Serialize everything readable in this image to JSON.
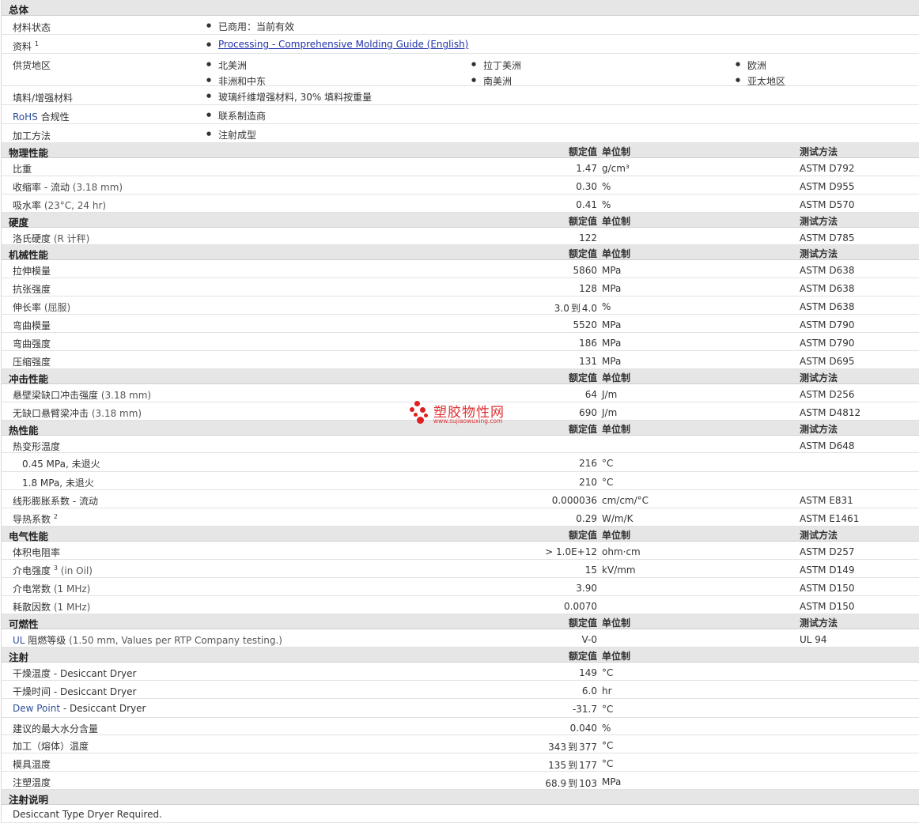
{
  "general": {
    "title": "总体",
    "material_status": {
      "label": "材料状态",
      "value": "已商用：当前有效"
    },
    "literature": {
      "label": "资料",
      "sup": "1",
      "link": "Processing - Comprehensive Molding Guide (English)"
    },
    "availability": {
      "label": "供货地区",
      "regions": [
        "北美洲",
        "拉丁美洲",
        "欧洲",
        "非洲和中东",
        "南美洲",
        "亚太地区"
      ]
    },
    "filler": {
      "label": "填料/增强材料",
      "value": "玻璃纤维增强材料, 30% 填料按重量"
    },
    "rohs": {
      "label_a": "RoHS",
      "label_b": " 合规性",
      "value": "联系制造商"
    },
    "processing_method": {
      "label": "加工方法",
      "value": "注射成型"
    }
  },
  "headers": {
    "nominal": "额定值",
    "unit": "单位制",
    "test": "测试方法"
  },
  "sections": [
    {
      "title": "物理性能",
      "rows": [
        {
          "label": "比重",
          "value": "1.47",
          "unit": "g/cm³",
          "test": "ASTM D792"
        },
        {
          "label": "收缩率 ",
          "suffix": "- 流动 ",
          "paren": "(3.18 mm)",
          "value": "0.30",
          "unit": "%",
          "test": "ASTM D955"
        },
        {
          "label": "吸水率 ",
          "paren": "(23°C, 24 hr)",
          "value": "0.41",
          "unit": "%",
          "test": "ASTM D570"
        }
      ]
    },
    {
      "title": "硬度",
      "rows": [
        {
          "label": "洛氏硬度 ",
          "paren": "(R 计秤)",
          "value": "122",
          "unit": "",
          "test": "ASTM D785"
        }
      ]
    },
    {
      "title": "机械性能",
      "rows": [
        {
          "label": "拉伸模量",
          "value": "5860",
          "unit": "MPa",
          "test": "ASTM D638"
        },
        {
          "label": "抗张强度",
          "value": "128",
          "unit": "MPa",
          "test": "ASTM D638"
        },
        {
          "label": "伸长率 ",
          "paren": "(屈服)",
          "value_from": "3.0",
          "to": "到",
          "value_to": "4.0",
          "unit": "%",
          "test": "ASTM D638"
        },
        {
          "label": "弯曲模量",
          "value": "5520",
          "unit": "MPa",
          "test": "ASTM D790"
        },
        {
          "label": "弯曲强度",
          "value": "186",
          "unit": "MPa",
          "test": "ASTM D790"
        },
        {
          "label": "压缩强度",
          "value": "131",
          "unit": "MPa",
          "test": "ASTM D695"
        }
      ]
    },
    {
      "title": "冲击性能",
      "rows": [
        {
          "label": "悬壁梁缺口冲击强度 ",
          "paren": "(3.18 mm)",
          "value": "64",
          "unit": "J/m",
          "test": "ASTM D256"
        },
        {
          "label": "无缺口悬臂梁冲击 ",
          "paren": "(3.18 mm)",
          "value": "690",
          "unit": "J/m",
          "test": "ASTM D4812"
        }
      ]
    },
    {
      "title": "热性能",
      "rows": [
        {
          "label": "热变形温度",
          "value": "",
          "unit": "",
          "test": "ASTM D648"
        },
        {
          "label": "0.45 MPa, 未退火",
          "indent": true,
          "value": "216",
          "unit": "°C",
          "test": ""
        },
        {
          "label": "1.8 MPa, 未退火",
          "indent": true,
          "value": "210",
          "unit": "°C",
          "test": ""
        },
        {
          "label": "线形膨胀系数 ",
          "suffix": "- 流动",
          "value": "0.000036",
          "unit": "cm/cm/°C",
          "test": "ASTM E831"
        },
        {
          "label": "导热系数 ",
          "sup": "2",
          "value": "0.29",
          "unit": "W/m/K",
          "test": "ASTM E1461"
        }
      ]
    },
    {
      "title": "电气性能",
      "rows": [
        {
          "label": "体积电阻率",
          "value": "> 1.0E+12",
          "unit": "ohm·cm",
          "test": "ASTM D257"
        },
        {
          "label": "介电强度 ",
          "sup": "3",
          "paren": " (in Oil)",
          "value": "15",
          "unit": "kV/mm",
          "test": "ASTM D149"
        },
        {
          "label": "介电常数 ",
          "paren": "(1 MHz)",
          "value": "3.90",
          "unit": "",
          "test": "ASTM D150"
        },
        {
          "label": "耗散因数 ",
          "paren": "(1 MHz)",
          "value": "0.0070",
          "unit": "",
          "test": "ASTM D150"
        }
      ]
    },
    {
      "title": "可燃性",
      "rows": [
        {
          "label_blue": "UL",
          "label": " 阻燃等级 ",
          "paren": "(1.50 mm, Values per RTP Company testing.)",
          "value": "V-0",
          "unit": "",
          "test": "UL 94"
        }
      ]
    },
    {
      "title": "注射",
      "no_test_header": true,
      "rows": [
        {
          "label": "干燥温度 ",
          "suffix": " - Desiccant Dryer",
          "value": "149",
          "unit": "°C",
          "test": ""
        },
        {
          "label": "干燥时间 ",
          "suffix": " - Desiccant Dryer",
          "value": "6.0",
          "unit": "hr",
          "test": ""
        },
        {
          "label_blue": "Dew Point",
          "label": "",
          "suffix": " - Desiccant Dryer",
          "value": "-31.7",
          "unit": "°C",
          "test": ""
        },
        {
          "label": "建议的最大水分含量",
          "value": "0.040",
          "unit": "%",
          "test": ""
        },
        {
          "label": "加工（熔体）温度",
          "value_from": "343",
          "to": "到",
          "value_to": "377",
          "unit": "°C",
          "test": ""
        },
        {
          "label": "模具温度",
          "value_from": "135",
          "to": "到",
          "value_to": "177",
          "unit": "°C",
          "test": ""
        },
        {
          "label": "注塑温度",
          "value_from": "68.9",
          "to": "到",
          "value_to": "103",
          "unit": "MPa",
          "test": ""
        }
      ]
    },
    {
      "title": "注射说明",
      "no_headers": true,
      "rows": [
        {
          "label": "Desiccant Type Dryer Required.",
          "value": "",
          "unit": "",
          "test": ""
        }
      ]
    }
  ],
  "watermark": {
    "title": "塑胶物性网",
    "url": "www.sujiaowuxing.com",
    "color": "#e02020"
  }
}
